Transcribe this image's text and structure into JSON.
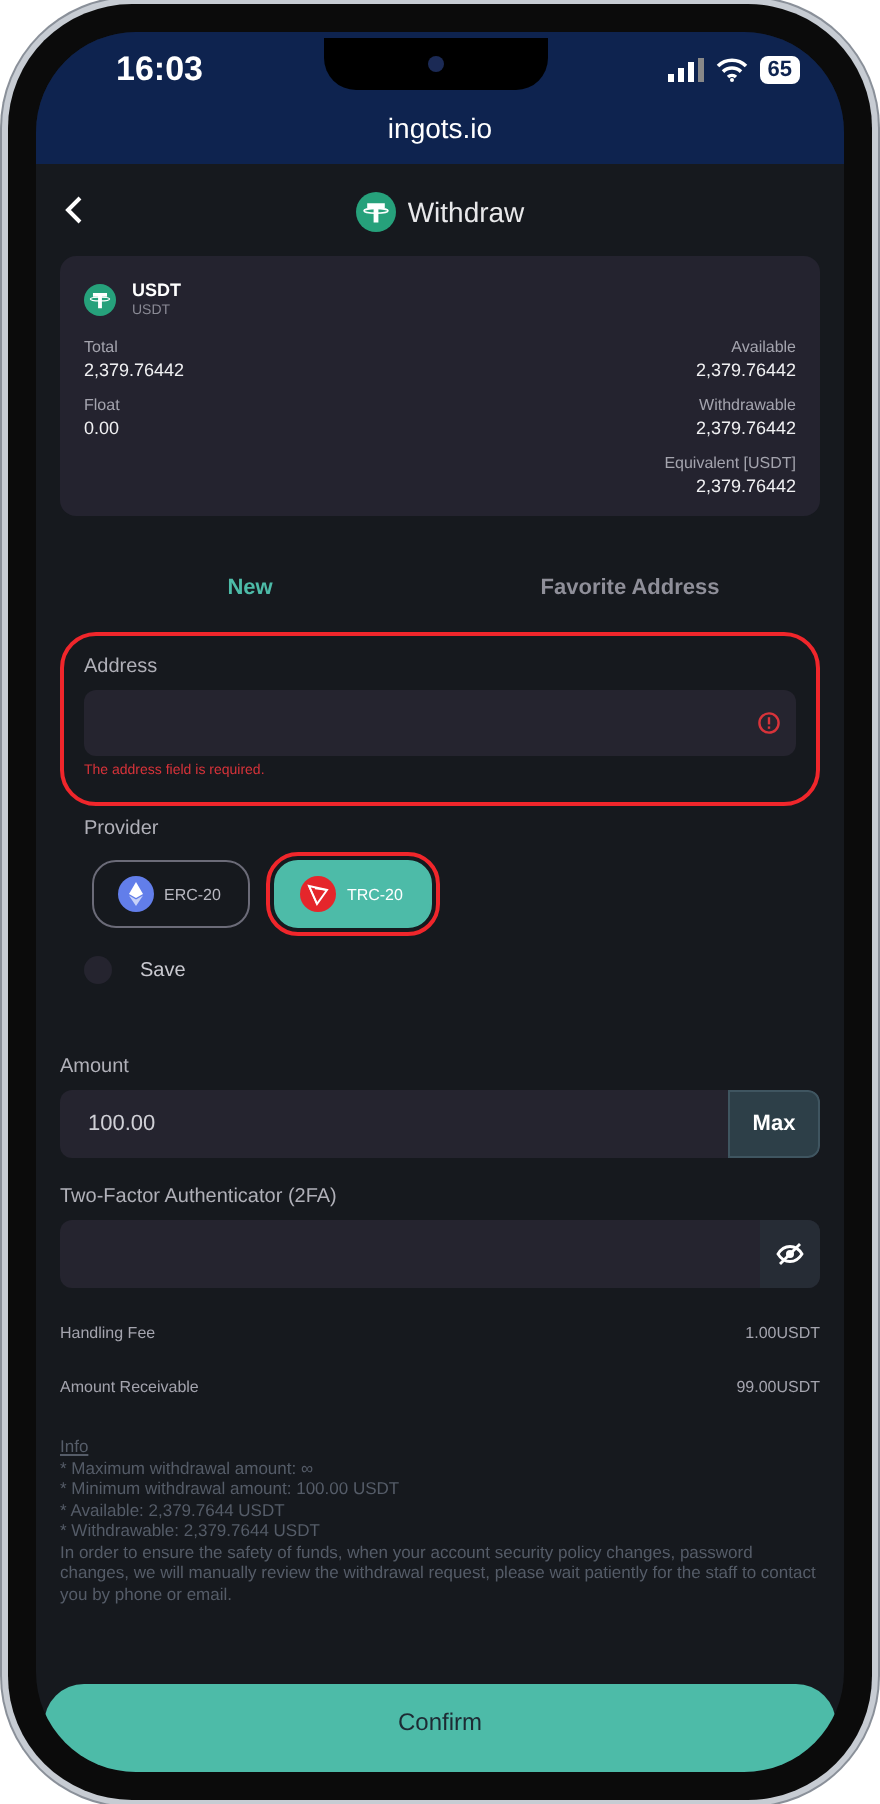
{
  "status_bar": {
    "time": "16:03",
    "battery": "65"
  },
  "browser": {
    "url": "ingots.io"
  },
  "header": {
    "title": "Withdraw"
  },
  "asset": {
    "symbol": "USDT",
    "name": "USDT",
    "left": [
      {
        "label": "Total",
        "value": "2,379.76442"
      },
      {
        "label": "Float",
        "value": "0.00"
      }
    ],
    "right": [
      {
        "label": "Available",
        "value": "2,379.76442"
      },
      {
        "label": "Withdrawable",
        "value": "2,379.76442"
      },
      {
        "label": "Equivalent [USDT]",
        "value": "2,379.76442"
      }
    ]
  },
  "tabs": [
    {
      "label": "New",
      "selected": true
    },
    {
      "label": "Favorite Address",
      "selected": false
    }
  ],
  "address": {
    "label": "Address",
    "error": "The address field is required.",
    "highlighted": true
  },
  "provider": {
    "label": "Provider",
    "options": [
      {
        "label": "ERC-20",
        "kind": "eth",
        "selected": false,
        "highlighted": false
      },
      {
        "label": "TRC-20",
        "kind": "tron",
        "selected": true,
        "highlighted": true
      }
    ]
  },
  "save": {
    "label": "Save",
    "checked": false
  },
  "amount": {
    "label": "Amount",
    "value": "100.00",
    "button": "Max"
  },
  "twofa": {
    "label": "Two-Factor Authenticator (2FA)"
  },
  "fees": [
    {
      "label": "Handling Fee",
      "value": "1.00USDT"
    },
    {
      "label": "Amount Receivable",
      "value": "99.00USDT"
    }
  ],
  "info": {
    "title": "Info",
    "lines": [
      "* Maximum withdrawal amount: ∞",
      "* Minimum withdrawal amount: 100.00 USDT",
      "* Available: 2,379.7644 USDT",
      "* Withdrawable: 2,379.7644 USDT"
    ],
    "note": "In order to ensure the safety of funds, when your account security policy changes, password changes, we will manually review the withdrawal request, please wait patiently for the staff to contact you by phone or email."
  },
  "confirm": "Confirm"
}
